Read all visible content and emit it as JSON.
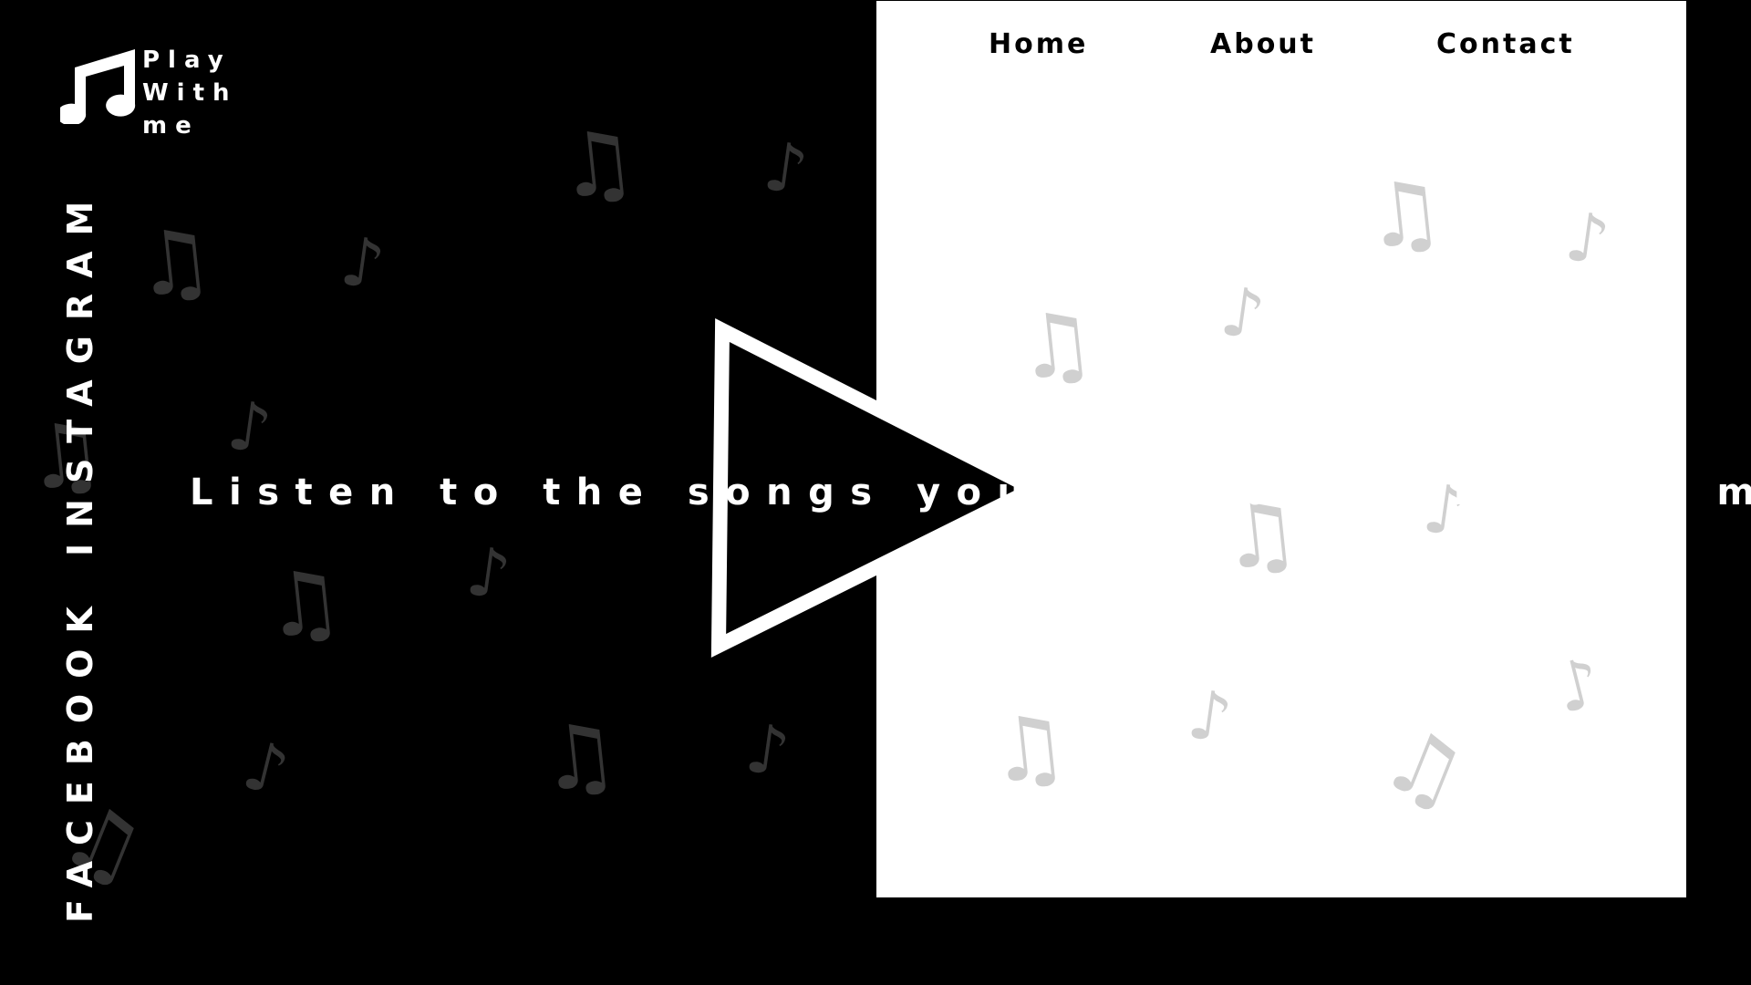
{
  "brand": {
    "lines": [
      "Play",
      "With",
      "me"
    ],
    "logo_icon": "music-notes-icon"
  },
  "nav": {
    "home": "Home",
    "about": "About",
    "contact": "Contact"
  },
  "social": {
    "instagram": "INSTAGRAM",
    "facebook": "FACEBOOK"
  },
  "hero": {
    "tagline": "Listen to the songs you love and millions more.",
    "play_icon": "play-triangle-icon"
  },
  "decor": {
    "note_icon": "music-note-icon",
    "dark_note_color": "#333333",
    "light_note_color": "#d0d0d0"
  },
  "colors": {
    "background": "#000000",
    "panel": "#ffffff",
    "text_on_dark": "#ffffff",
    "text_on_light": "#000000"
  }
}
